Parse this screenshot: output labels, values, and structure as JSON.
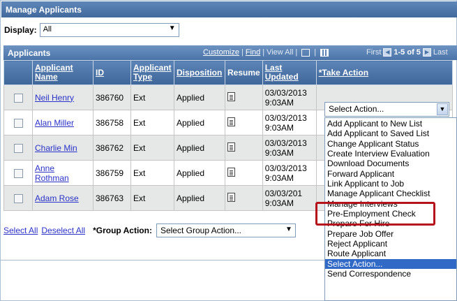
{
  "window": {
    "title": "Manage Applicants"
  },
  "display": {
    "label": "Display:",
    "value": "All"
  },
  "grid": {
    "title": "Applicants",
    "customize": "Customize",
    "find": "Find",
    "view_all": "View All",
    "first": "First",
    "range": "1-5 of 5",
    "last": "Last"
  },
  "columns": {
    "applicant_name": "Applicant Name",
    "id": "ID",
    "applicant_type": "Applicant Type",
    "disposition": "Disposition",
    "resume": "Resume",
    "last_updated": "Last Updated",
    "take_action": "*Take Action"
  },
  "rows": [
    {
      "name": "Neil Henry",
      "id": "386760",
      "type": "Ext",
      "disposition": "Applied",
      "updated": "03/03/2013 9:03AM"
    },
    {
      "name": "Alan Miller",
      "id": "386758",
      "type": "Ext",
      "disposition": "Applied",
      "updated": "03/03/2013 9:03AM"
    },
    {
      "name": "Charlie Min",
      "id": "386762",
      "type": "Ext",
      "disposition": "Applied",
      "updated": "03/03/2013 9:03AM"
    },
    {
      "name": "Anne Rothman",
      "id": "386759",
      "type": "Ext",
      "disposition": "Applied",
      "updated": "03/03/2013 9:03AM"
    },
    {
      "name": "Adam Rose",
      "id": "386763",
      "type": "Ext",
      "disposition": "Applied",
      "updated": "03/03/201 9:03AM"
    }
  ],
  "take_action": {
    "value": "Select Action...",
    "options": [
      "Add Applicant to New List",
      "Add Applicant to Saved List",
      "Change Applicant Status",
      "Create Interview Evaluation",
      "Download Documents",
      "Forward Applicant",
      "Link Applicant to Job",
      "Manage Applicant Checklist",
      "Manage Interviews",
      "Pre-Employment Check",
      "Prepare For Hire",
      "Prepare Job Offer",
      "Reject Applicant",
      "Route Applicant",
      "Select Action...",
      "Send Correspondence"
    ],
    "selected_option": "Select Action...",
    "highlighted_option": "Manage Interviews"
  },
  "footer": {
    "select_all": "Select All",
    "deselect_all": "Deselect All",
    "group_action_label": "*Group Action:",
    "group_action_value": "Select Group Action..."
  },
  "colors": {
    "header_blue": "#4a73a8",
    "link_blue": "#2a32c8",
    "highlight_red": "#b5121b",
    "selected_option": "#3169c6"
  }
}
